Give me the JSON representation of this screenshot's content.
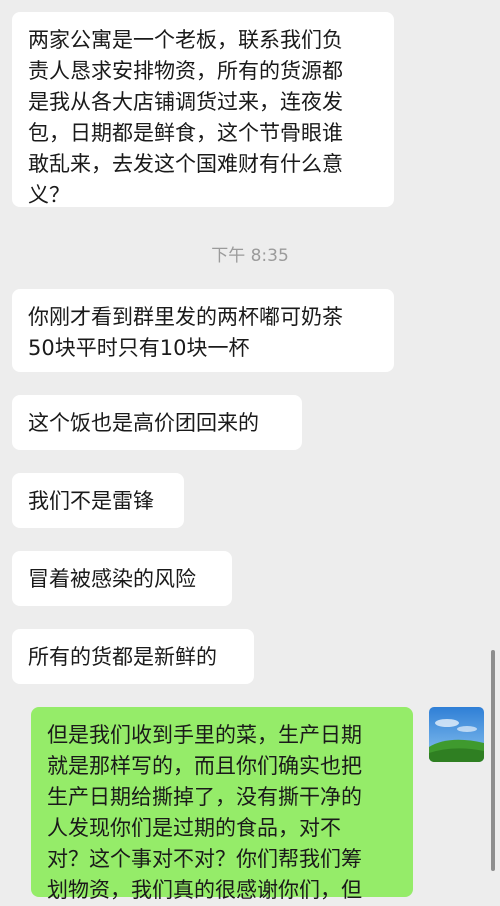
{
  "timestamp": "下午 8:35",
  "messages": [
    {
      "text": "两家公寓是一个老板，联系我们负\n责人恳求安排物资，所有的货源都\n是我从各大店铺调货过来，连夜发\n包，日期都是鲜食，这个节骨眼谁\n敢乱来，去发这个国难财有什么意\n义？"
    },
    {
      "text": "你刚才看到群里发的两杯嘟可奶茶\n50块平时只有10块一杯"
    },
    {
      "text": "这个饭也是高价团回来的"
    },
    {
      "text": "我们不是雷锋"
    },
    {
      "text": "冒着被感染的风险"
    },
    {
      "text": "所有的货都是新鲜的"
    }
  ],
  "sent_message": {
    "text": "但是我们收到手里的菜，生产日期\n就是那样写的，而且你们确实也把\n生产日期给撕掉了，没有撕干净的\n人发现你们是过期的食品，对不\n对？这个事对不对？你们帮我们筹\n划物资，我们真的很感谢你们，但"
  },
  "avatar": {
    "icon": "landscape-avatar-icon"
  },
  "colors": {
    "background": "#ededed",
    "received": "#ffffff",
    "sent": "#95ec69"
  }
}
